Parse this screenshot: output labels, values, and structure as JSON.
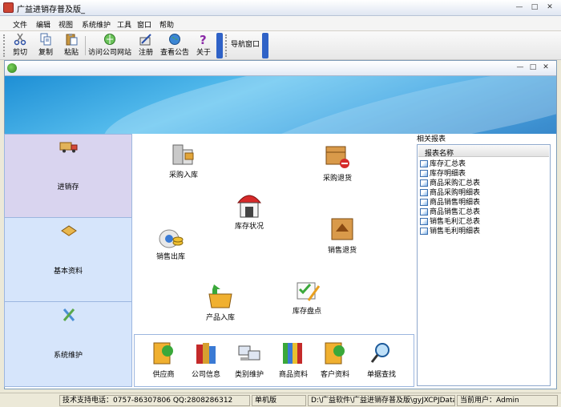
{
  "window": {
    "title": "广益进销存普及版_"
  },
  "menu": [
    "文件",
    "编辑",
    "视图",
    "系统维护",
    "工具",
    "窗口",
    "帮助"
  ],
  "toolbar": {
    "cut": "剪切",
    "copy": "复制",
    "paste": "粘贴",
    "visit_site": "访问公司网站",
    "register": "注册",
    "announce": "查看公告",
    "about": "关于",
    "nav_window": "导航窗口"
  },
  "nav": [
    {
      "label": "进销存",
      "icon": "truck-icon"
    },
    {
      "label": "基本资料",
      "icon": "book-icon"
    },
    {
      "label": "系统维护",
      "icon": "tools-icon"
    }
  ],
  "main": {
    "purchase_in": "采购入库",
    "purchase_return": "采购退货",
    "stock_status": "库存状况",
    "sales_out": "销售出库",
    "sales_return": "销售退货",
    "product_in": "产品入库",
    "stock_check": "库存盘点"
  },
  "bottom": [
    "供应商",
    "公司信息",
    "类别维护",
    "商品资料",
    "客户资料",
    "单据查找"
  ],
  "reports": {
    "title": "相关报表",
    "column": "报表名称",
    "items": [
      "库存汇总表",
      "库存明细表",
      "商品采购汇总表",
      "商品采购明细表",
      "商品销售明细表",
      "商品销售汇总表",
      "销售毛利汇总表",
      "销售毛利明细表"
    ]
  },
  "status": {
    "support": "技术支持电话：0757-86307806 QQ:2808286312",
    "edition": "单机版",
    "path": "D:\\广益软件\\广益进销存普及版\\gyJXCPJData.sys",
    "user": "当前用户：Admin"
  }
}
